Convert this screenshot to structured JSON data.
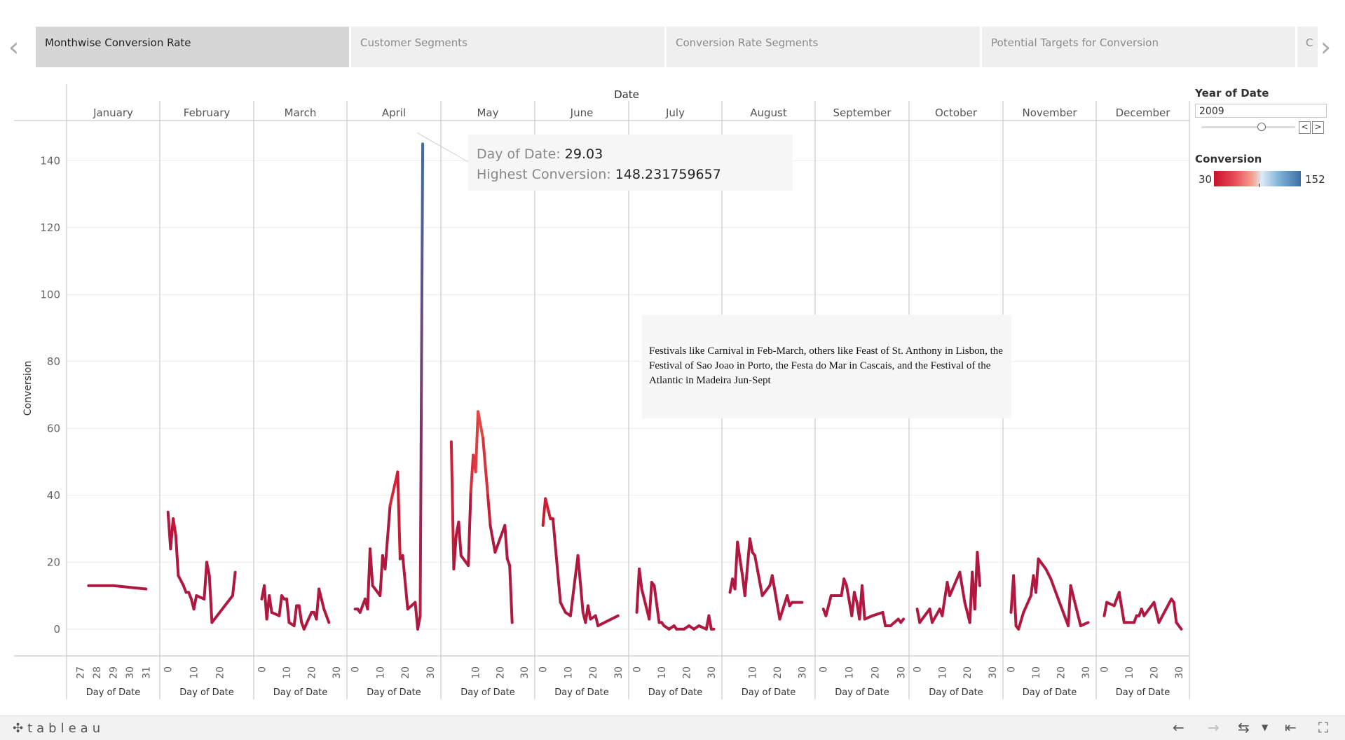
{
  "tabs": [
    {
      "label": "Monthwise Conversion Rate",
      "active": true
    },
    {
      "label": "Customer Segments",
      "active": false
    },
    {
      "label": "Conversion Rate Segments",
      "active": false
    },
    {
      "label": "Potential Targets for Conversion",
      "active": false
    },
    {
      "label": "C",
      "active": false
    }
  ],
  "nav": {
    "prev": "‹",
    "next": "›"
  },
  "sidebar": {
    "year_title": "Year of Date",
    "year_value": "2009",
    "step_prev": "<",
    "step_next": ">",
    "conversion_title": "Conversion",
    "legend_min": "30",
    "legend_max": "152"
  },
  "annotation": "Festivals like Carnival in Feb-March, others like Feast of St. Anthony in Lisbon, the Festival of Sao Joao in Porto, the Festa do Mar in Cascais, and the Festival of the Atlantic in Madeira Jun-Sept",
  "tooltip": {
    "label1": "Day of Date:",
    "value1": "29.03",
    "label2": "Highest Conversion:",
    "value2": "148.231759657"
  },
  "bottombar": {
    "logo": "tableau"
  },
  "chart_data": {
    "type": "line",
    "title": "",
    "column_header": "Date",
    "ylabel": "Conversion",
    "xlabel": "Day of Date",
    "ylim": [
      -8,
      152
    ],
    "yticks": [
      0,
      20,
      40,
      60,
      80,
      100,
      120,
      140
    ],
    "grid": true,
    "color_range": [
      30,
      152
    ],
    "panels": [
      {
        "month": "January",
        "xlim": [
          26.5,
          31.5
        ],
        "xticks": [
          27,
          28,
          29,
          30,
          31
        ],
        "points": [
          [
            27.5,
            13
          ],
          [
            29,
            13
          ],
          [
            31,
            12
          ]
        ]
      },
      {
        "month": "February",
        "xlim": [
          -1,
          31
        ],
        "xticks": [
          0,
          10,
          20
        ],
        "points": [
          [
            0,
            35
          ],
          [
            1,
            24
          ],
          [
            2,
            33
          ],
          [
            3,
            28
          ],
          [
            4,
            16
          ],
          [
            6,
            13
          ],
          [
            7,
            11
          ],
          [
            8,
            11
          ],
          [
            9,
            9
          ],
          [
            10,
            6
          ],
          [
            11,
            10
          ],
          [
            14,
            9
          ],
          [
            15,
            20
          ],
          [
            16,
            16
          ],
          [
            17,
            2
          ],
          [
            25,
            10
          ],
          [
            26,
            17
          ]
        ]
      },
      {
        "month": "March",
        "xlim": [
          -1,
          32
        ],
        "xticks": [
          0,
          10,
          20,
          30
        ],
        "points": [
          [
            0,
            9
          ],
          [
            1,
            13
          ],
          [
            2,
            3
          ],
          [
            3,
            10
          ],
          [
            4,
            5
          ],
          [
            7,
            4
          ],
          [
            8,
            10
          ],
          [
            9,
            9
          ],
          [
            10,
            9
          ],
          [
            11,
            2
          ],
          [
            13,
            1
          ],
          [
            14,
            7
          ],
          [
            15,
            7
          ],
          [
            16,
            2
          ],
          [
            17,
            0
          ],
          [
            20,
            5
          ],
          [
            21,
            5
          ],
          [
            22,
            3
          ],
          [
            23,
            12
          ],
          [
            25,
            6
          ],
          [
            27,
            2
          ]
        ]
      },
      {
        "month": "April",
        "xlim": [
          -1,
          32
        ],
        "xticks": [
          0,
          10,
          20,
          30
        ],
        "points": [
          [
            0,
            6
          ],
          [
            1,
            6
          ],
          [
            2,
            5
          ],
          [
            4,
            9
          ],
          [
            5,
            6
          ],
          [
            6,
            24
          ],
          [
            7,
            13
          ],
          [
            10,
            10
          ],
          [
            11,
            22
          ],
          [
            12,
            18
          ],
          [
            14,
            37
          ],
          [
            17,
            47
          ],
          [
            18,
            21
          ],
          [
            19,
            22
          ],
          [
            21,
            6
          ],
          [
            24,
            8
          ],
          [
            25,
            0
          ],
          [
            26,
            4
          ],
          [
            27,
            145
          ]
        ]
      },
      {
        "month": "May",
        "xlim": [
          -2,
          32
        ],
        "xticks": [
          10,
          20,
          30
        ],
        "points": [
          [
            0,
            56
          ],
          [
            1,
            18
          ],
          [
            2,
            28
          ],
          [
            3,
            32
          ],
          [
            4,
            22
          ],
          [
            7,
            19
          ],
          [
            8,
            41
          ],
          [
            9,
            52
          ],
          [
            10,
            47
          ],
          [
            11,
            65
          ],
          [
            13,
            57
          ],
          [
            15,
            40
          ],
          [
            16,
            31
          ],
          [
            18,
            23
          ],
          [
            22,
            31
          ],
          [
            23,
            21
          ],
          [
            24,
            19
          ],
          [
            25,
            2
          ]
        ]
      },
      {
        "month": "June",
        "xlim": [
          -1,
          32
        ],
        "xticks": [
          0,
          10,
          20,
          30
        ],
        "points": [
          [
            0,
            31
          ],
          [
            1,
            39
          ],
          [
            3,
            33
          ],
          [
            4,
            33
          ],
          [
            7,
            8
          ],
          [
            9,
            5
          ],
          [
            11,
            4
          ],
          [
            14,
            22
          ],
          [
            16,
            5
          ],
          [
            17,
            2
          ],
          [
            18,
            7
          ],
          [
            19,
            3
          ],
          [
            21,
            4
          ],
          [
            22,
            1
          ],
          [
            30,
            4
          ]
        ]
      },
      {
        "month": "July",
        "xlim": [
          -1,
          32
        ],
        "xticks": [
          0,
          10,
          20,
          30
        ],
        "points": [
          [
            0,
            5
          ],
          [
            1,
            18
          ],
          [
            2,
            12
          ],
          [
            5,
            3
          ],
          [
            6,
            14
          ],
          [
            7,
            13
          ],
          [
            9,
            2
          ],
          [
            10,
            2
          ],
          [
            11,
            1
          ],
          [
            13,
            0
          ],
          [
            15,
            1
          ],
          [
            16,
            0
          ],
          [
            19,
            0
          ],
          [
            21,
            1
          ],
          [
            23,
            0
          ],
          [
            25,
            1
          ],
          [
            28,
            0
          ],
          [
            29,
            4
          ],
          [
            30,
            0
          ],
          [
            31,
            0
          ]
        ]
      },
      {
        "month": "August",
        "xlim": [
          0,
          33
        ],
        "xticks": [
          10,
          20,
          30
        ],
        "points": [
          [
            1,
            11
          ],
          [
            2,
            15
          ],
          [
            3,
            12
          ],
          [
            4,
            26
          ],
          [
            6,
            16
          ],
          [
            7,
            10
          ],
          [
            9,
            27
          ],
          [
            10,
            23
          ],
          [
            11,
            22
          ],
          [
            14,
            10
          ],
          [
            17,
            13
          ],
          [
            18,
            16
          ],
          [
            21,
            3
          ],
          [
            24,
            10
          ],
          [
            25,
            7
          ],
          [
            26,
            8
          ],
          [
            30,
            8
          ]
        ]
      },
      {
        "month": "September",
        "xlim": [
          -1,
          31
        ],
        "xticks": [
          0,
          10,
          20,
          30
        ],
        "points": [
          [
            0,
            6
          ],
          [
            1,
            4
          ],
          [
            3,
            10
          ],
          [
            7,
            10
          ],
          [
            8,
            15
          ],
          [
            9,
            13
          ],
          [
            11,
            4
          ],
          [
            12,
            11
          ],
          [
            13,
            8
          ],
          [
            14,
            3
          ],
          [
            15,
            13
          ],
          [
            16,
            3
          ],
          [
            19,
            4
          ],
          [
            23,
            5
          ],
          [
            24,
            1
          ],
          [
            26,
            1
          ],
          [
            29,
            3
          ],
          [
            30,
            2
          ],
          [
            31,
            3
          ]
        ]
      },
      {
        "month": "October",
        "xlim": [
          -1,
          32
        ],
        "xticks": [
          0,
          10,
          20,
          30
        ],
        "points": [
          [
            0,
            6
          ],
          [
            1,
            2
          ],
          [
            5,
            6
          ],
          [
            6,
            2
          ],
          [
            9,
            6
          ],
          [
            10,
            4
          ],
          [
            12,
            14
          ],
          [
            13,
            10
          ],
          [
            17,
            17
          ],
          [
            19,
            8
          ],
          [
            21,
            2
          ],
          [
            22,
            17
          ],
          [
            23,
            6
          ],
          [
            24,
            23
          ],
          [
            25,
            13
          ]
        ]
      },
      {
        "month": "November",
        "xlim": [
          -1,
          32
        ],
        "xticks": [
          0,
          10,
          20,
          30
        ],
        "points": [
          [
            0,
            5
          ],
          [
            1,
            16
          ],
          [
            2,
            1
          ],
          [
            3,
            0
          ],
          [
            5,
            5
          ],
          [
            8,
            10
          ],
          [
            9,
            16
          ],
          [
            10,
            11
          ],
          [
            11,
            21
          ],
          [
            14,
            18
          ],
          [
            16,
            15
          ],
          [
            19,
            9
          ],
          [
            23,
            1
          ],
          [
            24,
            13
          ],
          [
            28,
            1
          ],
          [
            31,
            2
          ]
        ]
      },
      {
        "month": "December",
        "xlim": [
          -1,
          32
        ],
        "xticks": [
          0,
          10,
          20,
          30
        ],
        "points": [
          [
            0,
            4
          ],
          [
            1,
            8
          ],
          [
            4,
            7
          ],
          [
            6,
            11
          ],
          [
            8,
            2
          ],
          [
            12,
            2
          ],
          [
            13,
            4
          ],
          [
            14,
            4
          ],
          [
            15,
            6
          ],
          [
            16,
            4
          ],
          [
            20,
            8
          ],
          [
            22,
            2
          ],
          [
            27,
            9
          ],
          [
            28,
            8
          ],
          [
            29,
            2
          ],
          [
            31,
            0
          ]
        ]
      }
    ]
  }
}
